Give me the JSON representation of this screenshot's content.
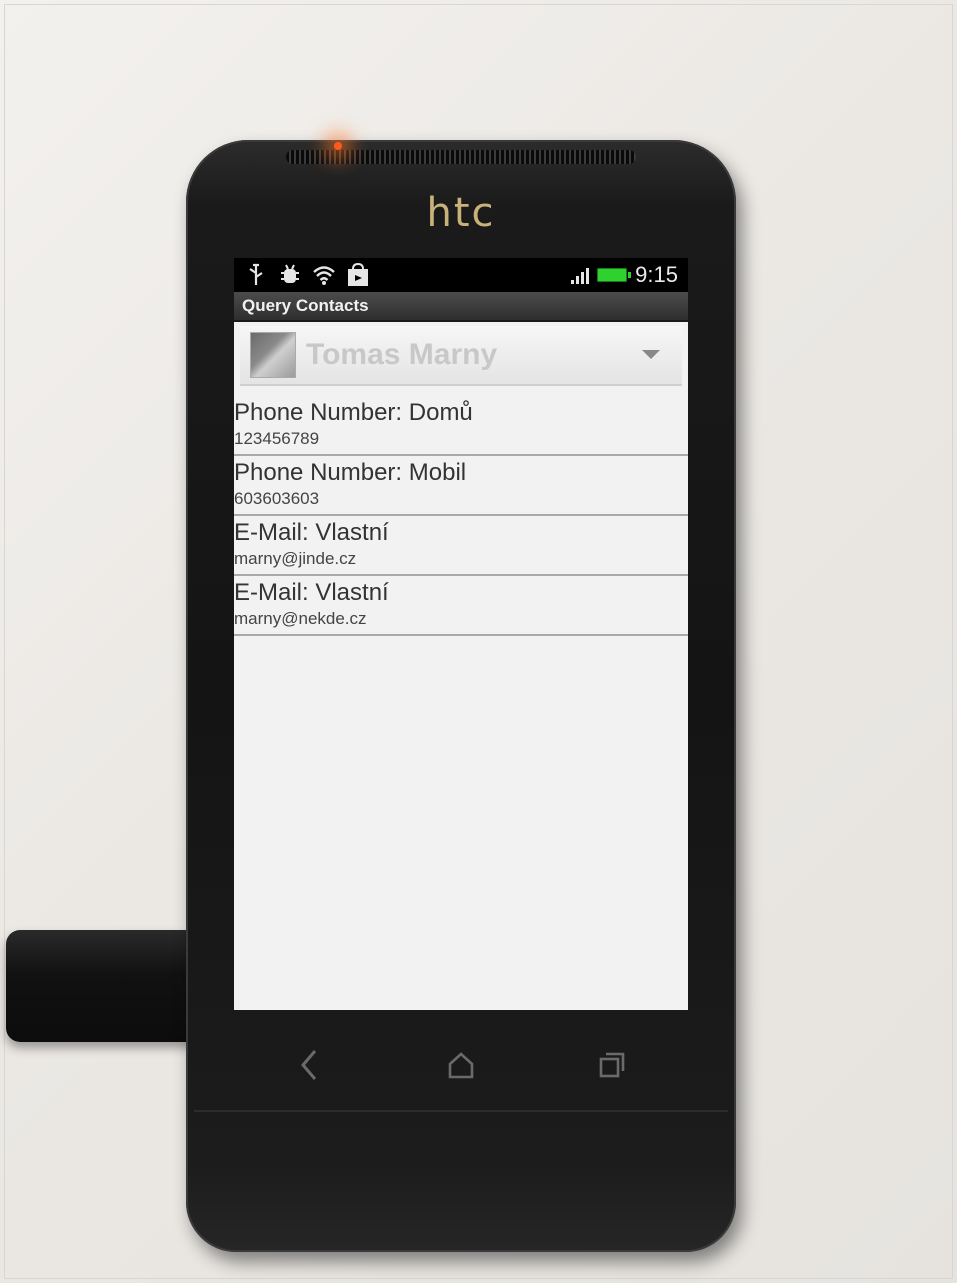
{
  "device": {
    "brand": "htc"
  },
  "status_bar": {
    "icons": [
      "usb-icon",
      "debug-icon",
      "wifi-icon",
      "market-icon"
    ],
    "clock": "9:15",
    "battery_color": "#2fd12f"
  },
  "app": {
    "title": "Query Contacts"
  },
  "spinner": {
    "selected": "Tomas Marny"
  },
  "entries": [
    {
      "label": "Phone Number: Domů",
      "value": "123456789"
    },
    {
      "label": "Phone Number: Mobil",
      "value": "603603603"
    },
    {
      "label": "E-Mail: Vlastní",
      "value": "marny@jinde.cz"
    },
    {
      "label": "E-Mail: Vlastní",
      "value": "marny@nekde.cz"
    }
  ],
  "navigation": {
    "buttons": [
      "back-icon",
      "home-icon",
      "recent-apps-icon"
    ]
  }
}
